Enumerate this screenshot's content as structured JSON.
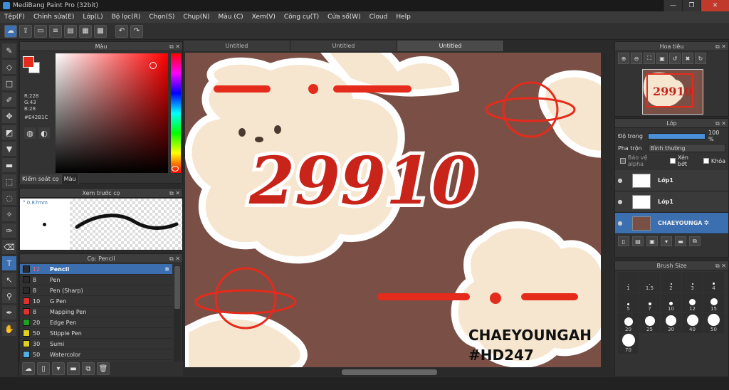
{
  "app": {
    "title": "MediBang Paint Pro (32bit)"
  },
  "window": {
    "min": "—",
    "max": "❐",
    "close": "✕"
  },
  "menu": [
    "Tệp(F)",
    "Chỉnh sửa(E)",
    "Lớp(L)",
    "Bộ lọc(R)",
    "Chọn(S)",
    "Chụp(N)",
    "Màu (C)",
    "Xem(V)",
    "Công cụ(T)",
    "Cửa sổ(W)",
    "Cloud",
    "Help"
  ],
  "toolbar_icons": [
    "cloud-icon",
    "share-icon",
    "chat-icon",
    "layers-icon",
    "document-icon",
    "grid-icon",
    "tiles-icon",
    "undo-icon",
    "redo-icon"
  ],
  "color_panel": {
    "title": "Màu",
    "r": "R:228",
    "g": "G:43",
    "b": "B:28",
    "hex": "#E42B1C",
    "tab_control": "Kiểm soát cọ",
    "tab_color": "Màu",
    "fg_color": "#E42B1C"
  },
  "preview_panel": {
    "title": "Xem trước cọ",
    "size": "0.87mm"
  },
  "brush_panel": {
    "title": "Cọ: Pencil",
    "items": [
      {
        "size": "12",
        "name": "Pencil",
        "color": "#2a2a2a",
        "selected": true
      },
      {
        "size": "8",
        "name": "Pen",
        "color": "#2a2a2a"
      },
      {
        "size": "8",
        "name": "Pen (Sharp)",
        "color": "#2a2a2a"
      },
      {
        "size": "10",
        "name": "G Pen",
        "color": "#e03030"
      },
      {
        "size": "8",
        "name": "Mapping Pen",
        "color": "#e03030"
      },
      {
        "size": "20",
        "name": "Edge Pen",
        "color": "#20a020"
      },
      {
        "size": "50",
        "name": "Stipple Pen",
        "color": "#e0d020"
      },
      {
        "size": "30",
        "name": "Sumi",
        "color": "#e0d020"
      },
      {
        "size": "50",
        "name": "Watercolor",
        "color": "#50b0e0"
      }
    ]
  },
  "tabs": [
    "Untitled",
    "Untitled",
    "Untitled"
  ],
  "canvas": {
    "big_text": "29910",
    "name_text": "CHAEYOUNGAH",
    "tag_text": "#HD247"
  },
  "nav_panel": {
    "title": "Hoa tiêu"
  },
  "layer_panel": {
    "title": "Lớp",
    "opacity_label": "Độ trong",
    "opacity_value": "100 %",
    "blend_label": "Pha trộn",
    "blend_value": "Bình thường",
    "chk_alpha": "Bảo vệ alpha",
    "chk_clip": "Xén bớt",
    "chk_lock": "Khóa",
    "layers": [
      {
        "name": "Lớp1"
      },
      {
        "name": "Lớp1"
      },
      {
        "name": "CHAEYOUNGA",
        "selected": true
      }
    ]
  },
  "size_panel": {
    "title": "Brush Size",
    "sizes": [
      "1",
      "1.5",
      "2",
      "3",
      "4",
      "5",
      "7",
      "10",
      "12",
      "15",
      "20",
      "25",
      "30",
      "40",
      "50",
      "70"
    ]
  }
}
